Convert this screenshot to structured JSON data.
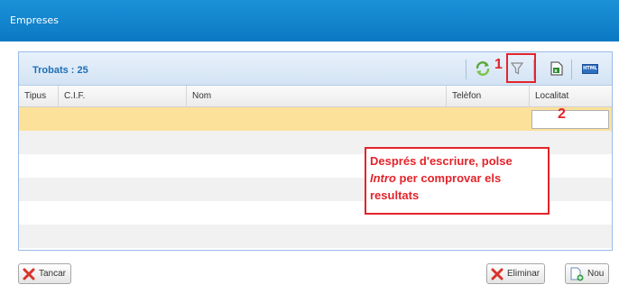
{
  "window": {
    "title": "Empreses"
  },
  "grid": {
    "found_label": "Trobats : 25",
    "columns": [
      "Tipus",
      "C.I.F.",
      "Nom",
      "Telèfon",
      "Localitat"
    ]
  },
  "toolbar": {
    "refresh_icon": "refresh-icon",
    "filter_icon": "filter-icon",
    "excel_icon": "excel-export-icon",
    "html_icon": "html-export-icon",
    "html_icon_text": "HTML"
  },
  "annotations": {
    "marker_1": "1",
    "marker_2": "2",
    "note_line1": "Després d'escriure, polse",
    "note_italic": "Intro",
    "note_line2_rest": " per comprovar els",
    "note_line3": "resultats",
    "accent_color": "#e3242b"
  },
  "buttons": {
    "close": "Tancar",
    "delete": "Eliminar",
    "new": "Nou"
  }
}
